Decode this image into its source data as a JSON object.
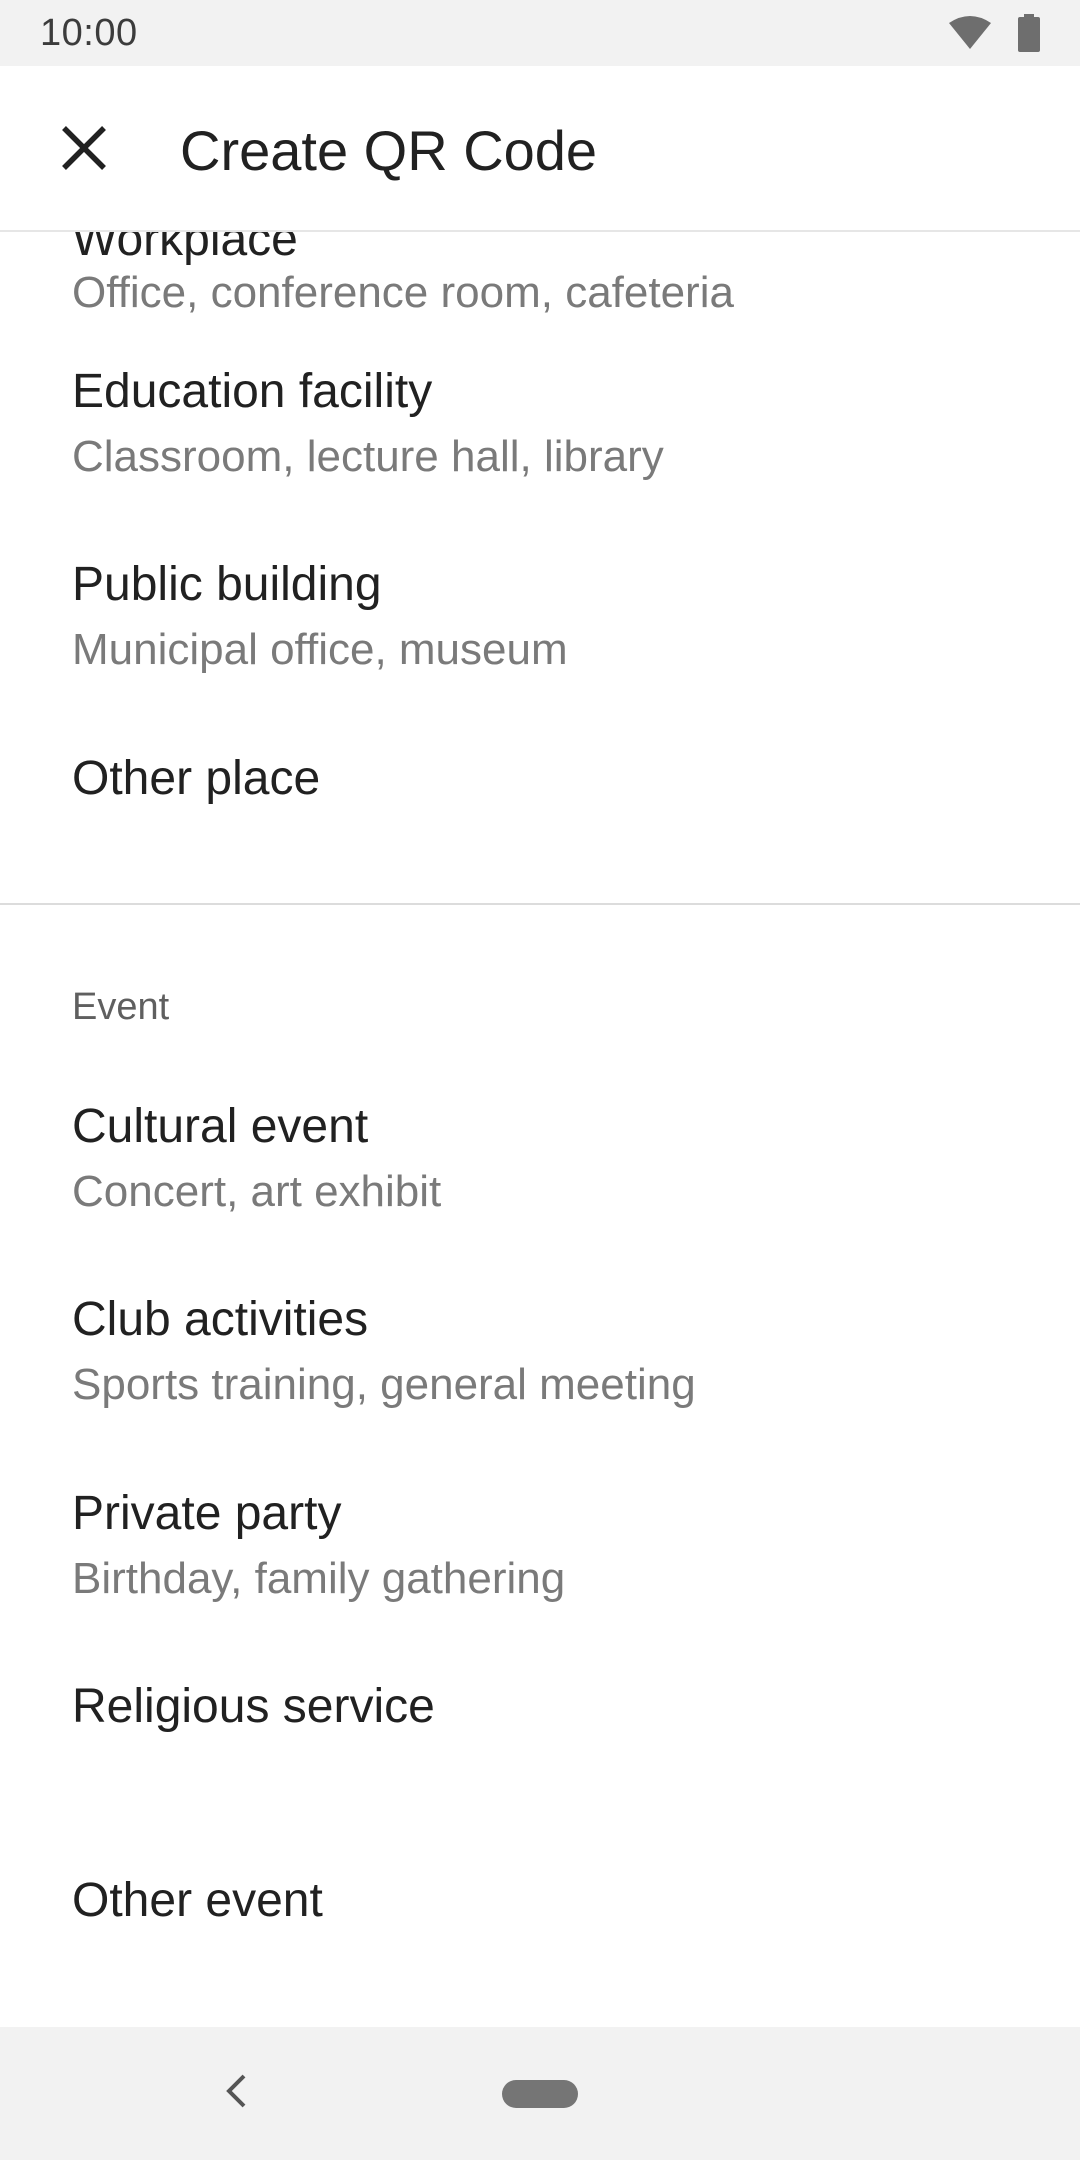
{
  "status_bar": {
    "time": "10:00",
    "wifi_icon": "wifi-icon",
    "battery_icon": "battery-icon"
  },
  "app_bar": {
    "close_icon": "close-icon",
    "title": "Create QR Code"
  },
  "places": {
    "partial_item": {
      "title": "Workplace",
      "subtitle": "Office, conference room, cafeteria"
    },
    "items": [
      {
        "title": "Education facility",
        "subtitle": "Classroom, lecture hall, library"
      },
      {
        "title": "Public building",
        "subtitle": "Municipal office, museum"
      },
      {
        "title": "Other place",
        "subtitle": ""
      }
    ]
  },
  "events": {
    "header": "Event",
    "items": [
      {
        "title": "Cultural event",
        "subtitle": "Concert, art exhibit"
      },
      {
        "title": "Club activities",
        "subtitle": "Sports training, general meeting"
      },
      {
        "title": "Private party",
        "subtitle": "Birthday, family gathering"
      },
      {
        "title": "Religious service",
        "subtitle": ""
      },
      {
        "title": "Other event",
        "subtitle": ""
      }
    ]
  },
  "nav_bar": {
    "back_icon": "back-icon",
    "home_icon": "home-pill-icon"
  },
  "colors": {
    "title_text": "#212121",
    "subtitle_text": "#7a7a7a",
    "bars_background": "#f2f2f2",
    "divider": "#dcdcdc"
  }
}
